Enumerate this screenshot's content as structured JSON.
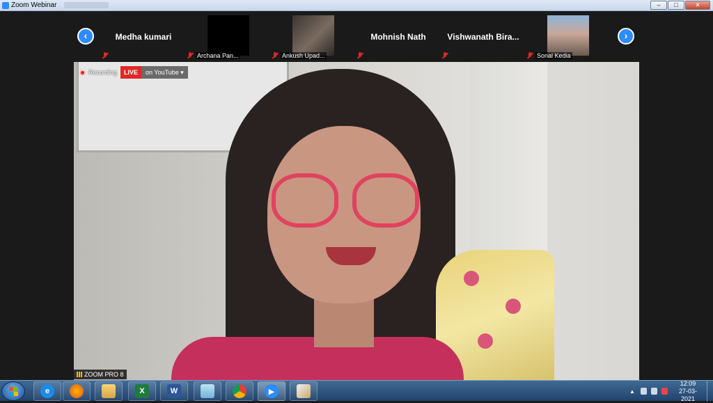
{
  "window": {
    "title": "Zoom Webinar"
  },
  "filmstrip": {
    "participants": [
      {
        "name": "Medha kumari",
        "label": ""
      },
      {
        "name": "",
        "label": "Archana Pan..."
      },
      {
        "name": "",
        "label": "Ankush Upad..."
      },
      {
        "name": "Mohnish Nath",
        "label": ""
      },
      {
        "name": "Vishwanath  Bira...",
        "label": ""
      },
      {
        "name": "",
        "label": "Sonal Kedia"
      }
    ]
  },
  "main_video": {
    "recording_label": "Recording",
    "live_label": "LIVE",
    "youtube_label": "on YouTube",
    "speaker_label": "ZOOM PRO 8"
  },
  "taskbar": {
    "time": "12:09",
    "date": "27-03-2021",
    "apps": [
      "internet-explorer",
      "firefox",
      "file-explorer",
      "excel",
      "word",
      "notepad",
      "chrome",
      "zoom",
      "paint"
    ]
  },
  "colors": {
    "accent": "#2d8cff",
    "live": "#e02828",
    "taskbar": "#2b527e"
  }
}
